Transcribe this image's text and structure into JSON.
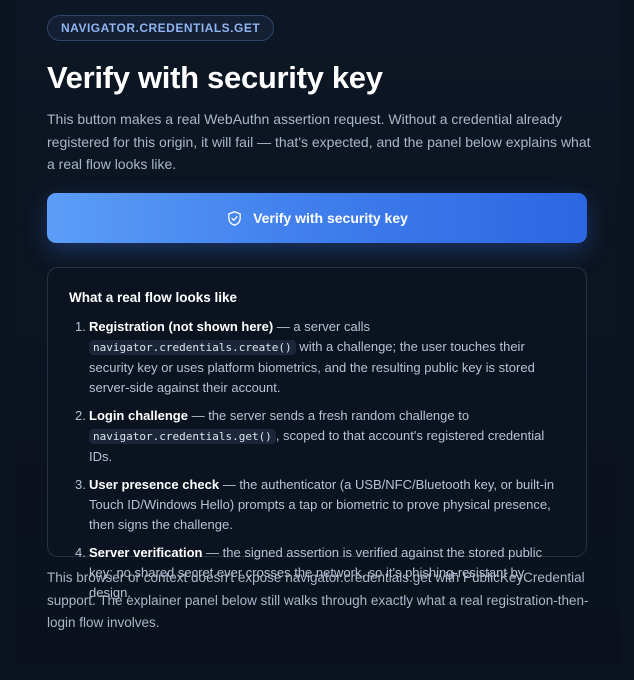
{
  "badge": "NAVIGATOR.CREDENTIALS.GET",
  "title": "Verify with security key",
  "intro": "This button makes a real WebAuthn assertion request. Without a credential already registered for this origin, it will fail — that's expected, and the panel below explains what a real flow looks like.",
  "verify_button": {
    "label": "Verify with security key",
    "icon": "shield-check-icon"
  },
  "panel": {
    "heading": "What a real flow looks like",
    "steps": [
      {
        "num": "1.",
        "title": "Registration (not shown here)",
        "pre": " — a server calls ",
        "code": "navigator.credentials.create()",
        "post": " with a challenge; the user touches their security key or uses platform biometrics, and the resulting public key is stored server-side against their account."
      },
      {
        "num": "2.",
        "title": "Login challenge",
        "pre": " — the server sends a fresh random challenge to ",
        "code": "navigator.credentials.get()",
        "post": ", scoped to that account's registered credential IDs."
      },
      {
        "num": "3.",
        "title": "User presence check",
        "pre": " — the authenticator (a USB/NFC/Bluetooth key, or built-in Touch ID/Windows Hello) prompts a tap or biometric to prove physical presence, then signs the challenge.",
        "code": "",
        "post": ""
      },
      {
        "num": "4.",
        "title": "Server verification",
        "pre": " — the signed assertion is verified against the stored public key; no shared secret ever crosses the network, so it's phishing-resistant by design.",
        "code": "",
        "post": ""
      }
    ]
  },
  "outro": "This browser or context doesn't expose navigator.credentials.get with PublicKeyCredential support. The explainer panel below still walks through exactly what a real registration-then-login flow involves.",
  "colors": {
    "background": "#0c1320",
    "accent": "#3f7eec",
    "badge_text": "#8fb4f0"
  }
}
